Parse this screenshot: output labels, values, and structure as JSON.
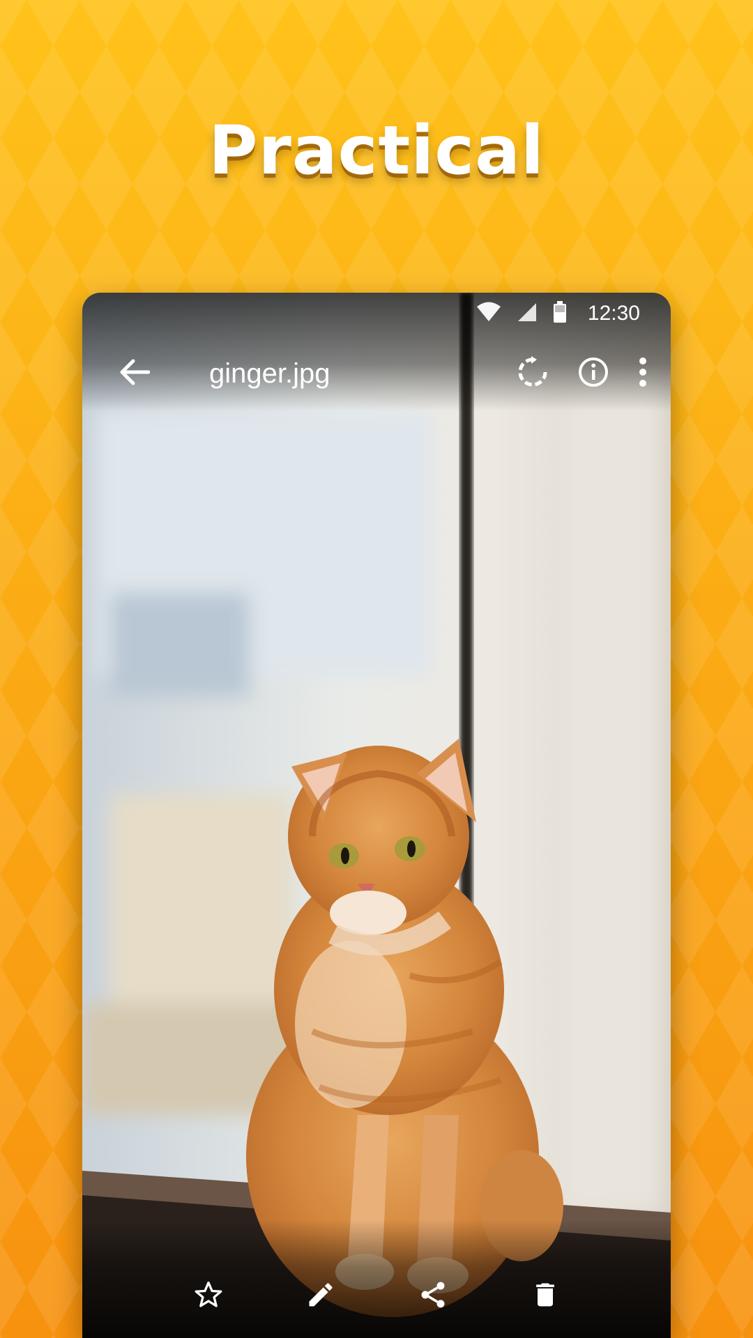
{
  "headline": "Practical",
  "status_bar": {
    "time": "12:30"
  },
  "toolbar": {
    "title": "ginger.jpg"
  },
  "icons": {
    "back": "arrow-back-icon",
    "rotate": "rotate-icon",
    "info": "info-icon",
    "more": "more-vert-icon",
    "wifi": "wifi-icon",
    "signal": "signal-icon",
    "battery": "battery-icon",
    "favorite": "star-outline-icon",
    "edit": "pencil-icon",
    "share": "share-icon",
    "delete": "trash-icon"
  },
  "colors": {
    "background_top": "#ffc21a",
    "background_bottom": "#f7920f",
    "icon": "#ffffff"
  }
}
